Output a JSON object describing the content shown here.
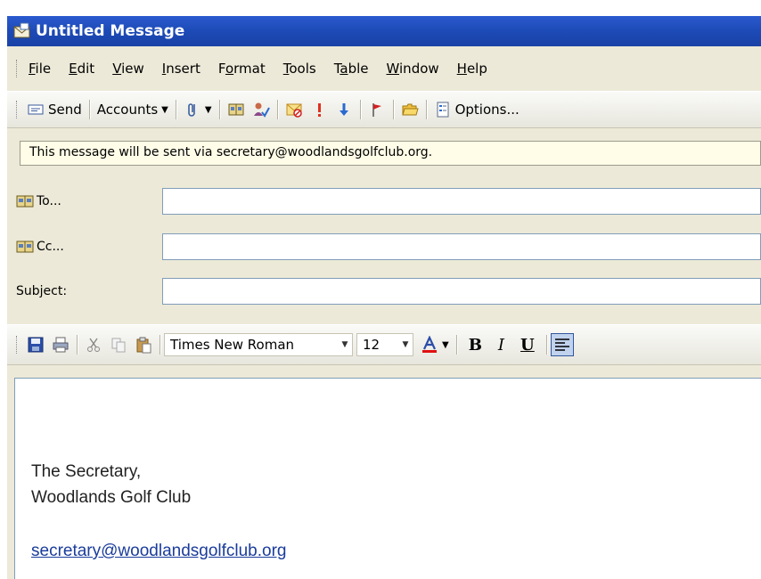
{
  "window": {
    "title": "Untitled Message"
  },
  "menu": {
    "items": [
      {
        "pre": "",
        "key": "F",
        "post": "ile"
      },
      {
        "pre": "",
        "key": "E",
        "post": "dit"
      },
      {
        "pre": "",
        "key": "V",
        "post": "iew"
      },
      {
        "pre": "",
        "key": "I",
        "post": "nsert"
      },
      {
        "pre": "F",
        "key": "o",
        "post": "rmat"
      },
      {
        "pre": "",
        "key": "T",
        "post": "ools"
      },
      {
        "pre": "T",
        "key": "a",
        "post": "ble"
      },
      {
        "pre": "",
        "key": "W",
        "post": "indow"
      },
      {
        "pre": "",
        "key": "H",
        "post": "elp"
      }
    ]
  },
  "toolbar": {
    "send_label": "Send",
    "accounts_label": "Accounts",
    "options_label": "Options..."
  },
  "infobar": {
    "text": "This message will be sent via secretary@woodlandsgolfclub.org."
  },
  "address": {
    "to_label": "To...",
    "cc_label": "Cc...",
    "subject_label": "Subject:",
    "to_value": "",
    "cc_value": "",
    "subject_value": ""
  },
  "format": {
    "font_name": "Times New Roman",
    "font_size": "12",
    "bold": "B",
    "italic": "I",
    "underline": "U",
    "font_color": "#e01010"
  },
  "body": {
    "line1": "The Secretary,",
    "line2": "Woodlands Golf Club",
    "link": "secretary@woodlandsgolfclub.org"
  }
}
